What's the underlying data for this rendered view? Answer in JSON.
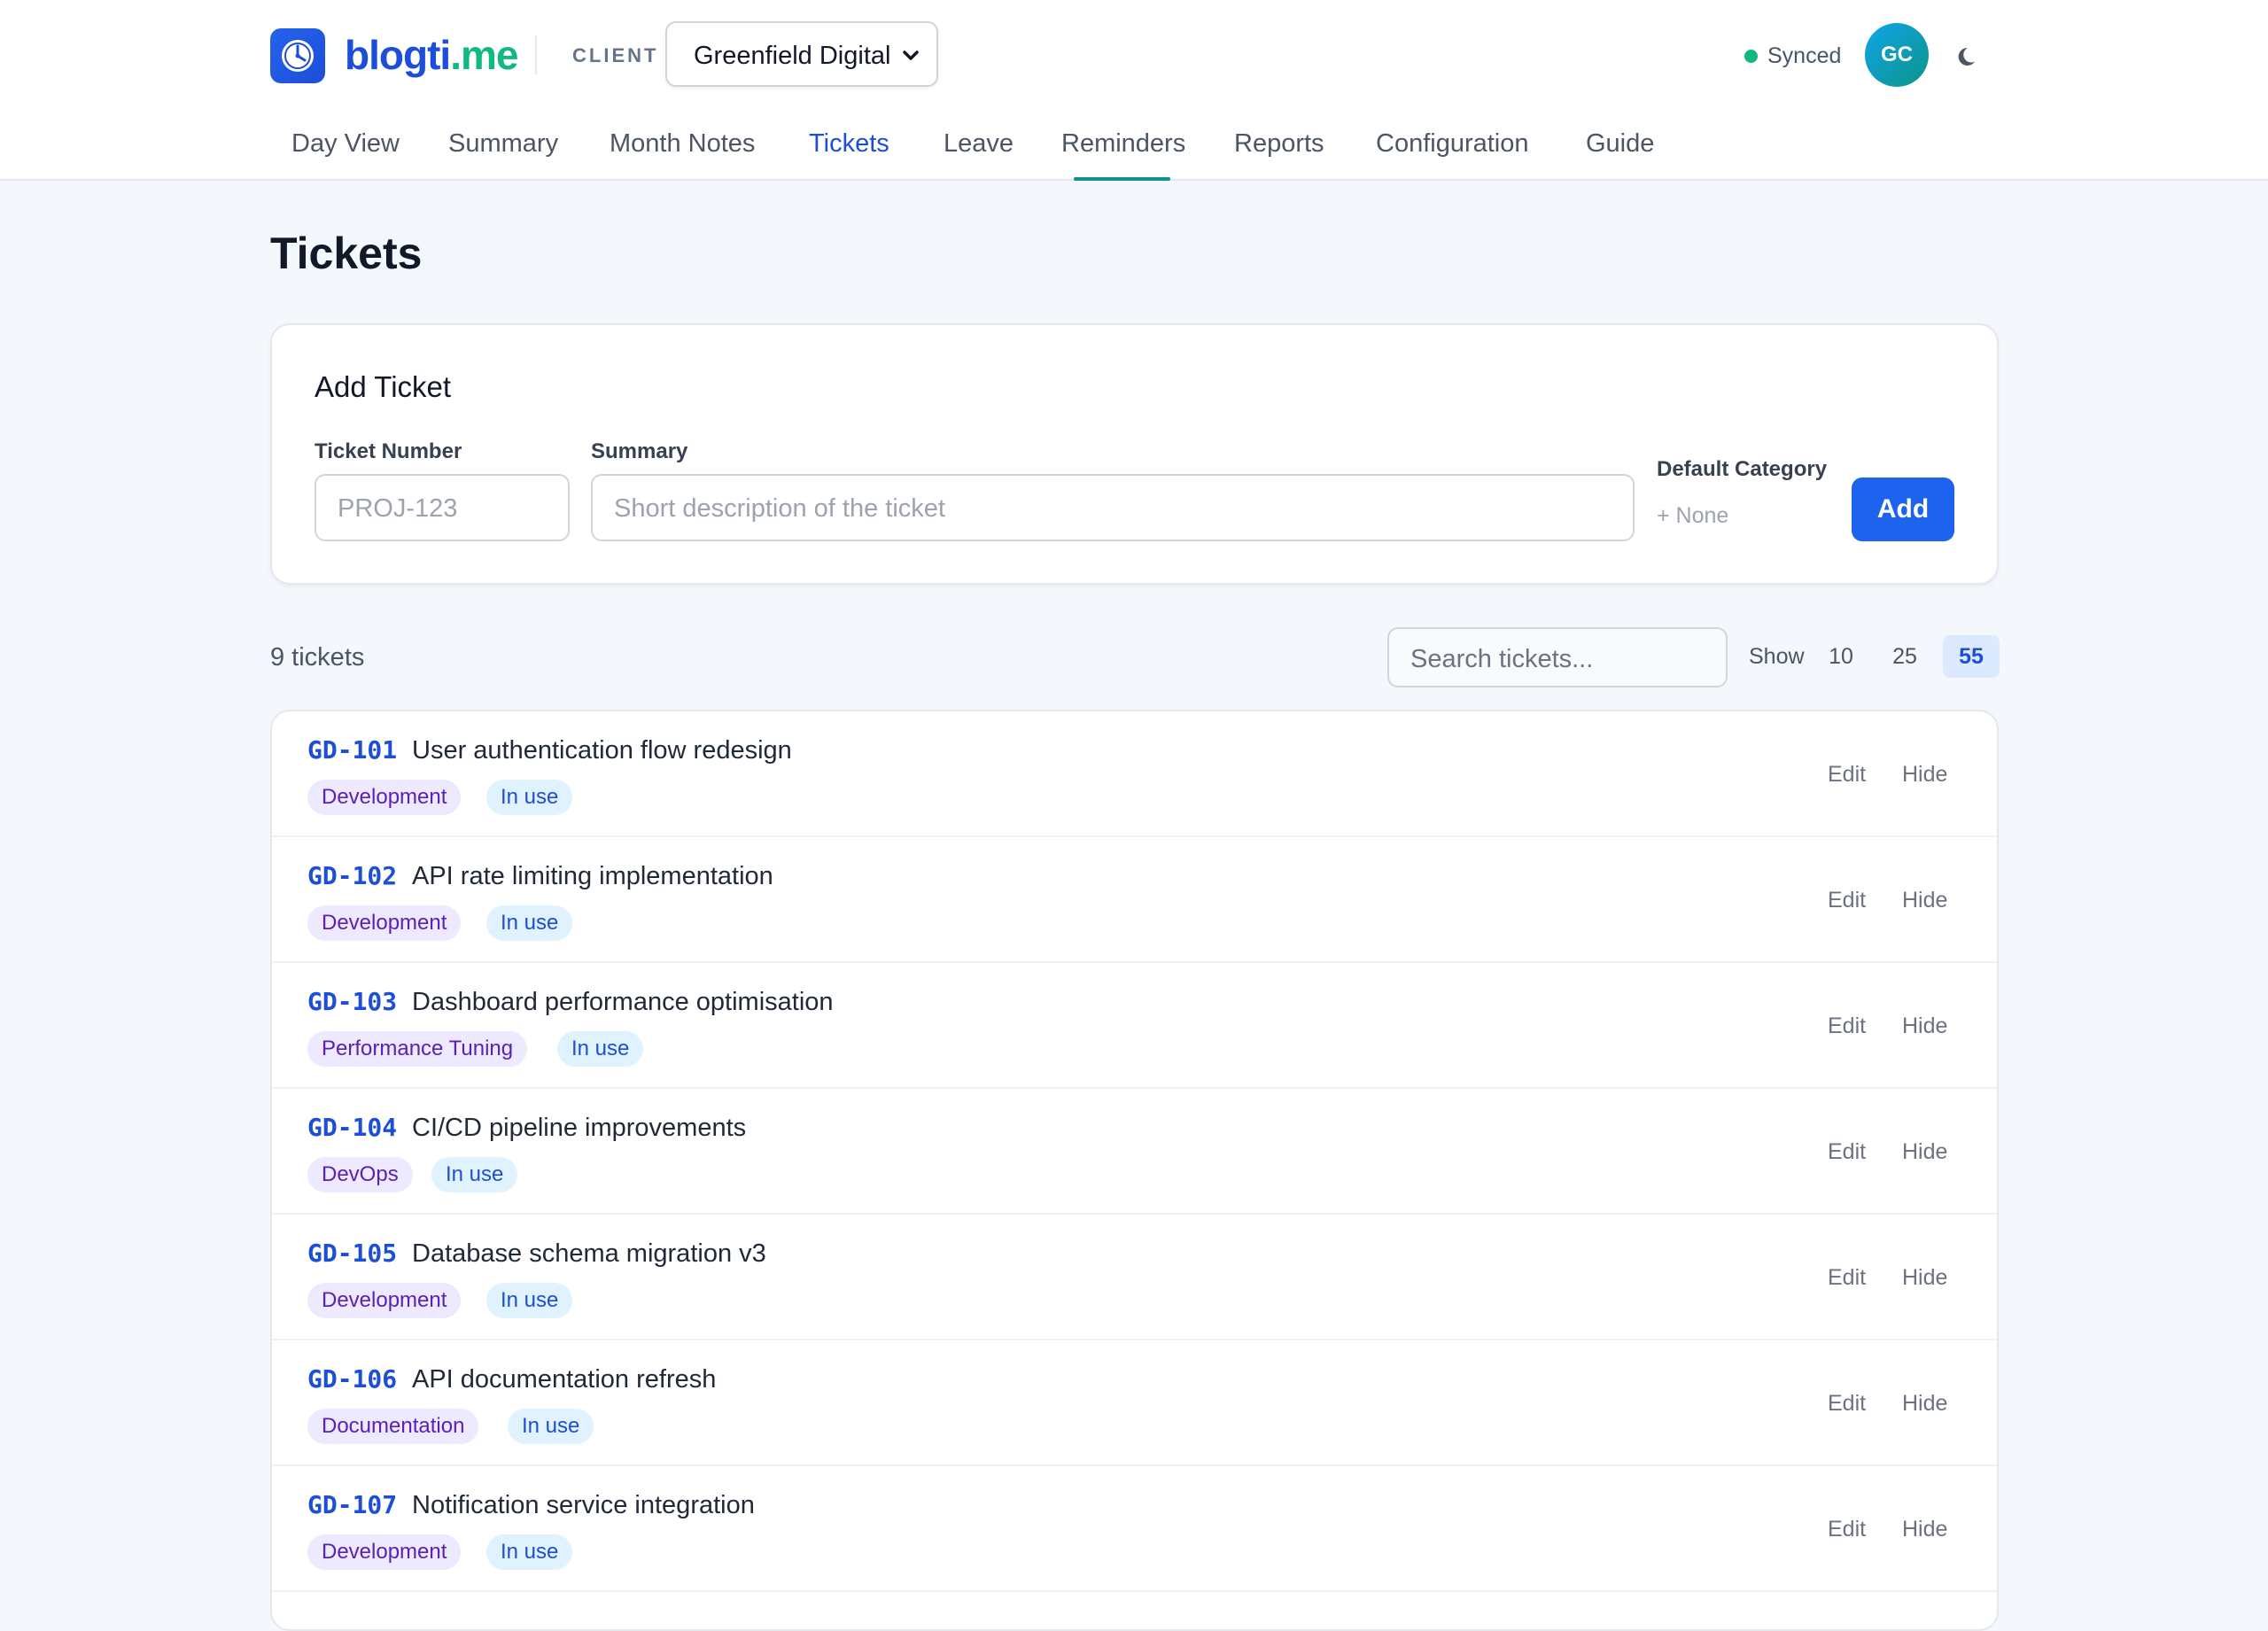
{
  "brand": {
    "part1": "blogti",
    "part2": ".me"
  },
  "client": {
    "label": "CLIENT",
    "selected": "Greenfield Digital"
  },
  "status": {
    "sync_text": "Synced",
    "avatar_initials": "GC"
  },
  "nav": {
    "items": [
      {
        "label": "Day View"
      },
      {
        "label": "Summary"
      },
      {
        "label": "Month Notes"
      },
      {
        "label": "Tickets",
        "active": true
      },
      {
        "label": "Leave"
      },
      {
        "label": "Reminders"
      },
      {
        "label": "Reports"
      },
      {
        "label": "Configuration"
      },
      {
        "label": "Guide"
      }
    ]
  },
  "page": {
    "title": "Tickets"
  },
  "add_ticket": {
    "title": "Add Ticket",
    "ticket_number_label": "Ticket Number",
    "ticket_number_placeholder": "PROJ-123",
    "summary_label": "Summary",
    "summary_placeholder": "Short description of the ticket",
    "default_category_label": "Default Category",
    "default_category_value": "+ None",
    "add_button": "Add"
  },
  "list_controls": {
    "count_text": "9 tickets",
    "search_placeholder": "Search tickets...",
    "show_label": "Show",
    "page_sizes": [
      "10",
      "25",
      "55"
    ],
    "selected_page_size": "55"
  },
  "tickets": [
    {
      "id": "GD-101",
      "summary": "User authentication flow redesign",
      "category": "Development",
      "status": "In use",
      "edit": "Edit",
      "hide": "Hide"
    },
    {
      "id": "GD-102",
      "summary": "API rate limiting implementation",
      "category": "Development",
      "status": "In use",
      "edit": "Edit",
      "hide": "Hide"
    },
    {
      "id": "GD-103",
      "summary": "Dashboard performance optimisation",
      "category": "Performance Tuning",
      "status": "In use",
      "edit": "Edit",
      "hide": "Hide"
    },
    {
      "id": "GD-104",
      "summary": "CI/CD pipeline improvements",
      "category": "DevOps",
      "status": "In use",
      "edit": "Edit",
      "hide": "Hide"
    },
    {
      "id": "GD-105",
      "summary": "Database schema migration v3",
      "category": "Development",
      "status": "In use",
      "edit": "Edit",
      "hide": "Hide"
    },
    {
      "id": "GD-106",
      "summary": "API documentation refresh",
      "category": "Documentation",
      "status": "In use",
      "edit": "Edit",
      "hide": "Hide"
    },
    {
      "id": "GD-107",
      "summary": "Notification service integration",
      "category": "Development",
      "status": "In use",
      "edit": "Edit",
      "hide": "Hide"
    }
  ],
  "colors": {
    "brand_primary": "#1d4ed8",
    "brand_accent": "#10b981",
    "active_tab_underline": "#0d9488",
    "add_button": "#1d63ed",
    "category_tag_bg": "#ede9fe",
    "status_tag_bg": "#e0f2fe",
    "synced_dot": "#10b981"
  },
  "icons": {
    "logo": "clock-icon",
    "client_dropdown": "chevron-down-icon",
    "theme": "moon-icon"
  }
}
